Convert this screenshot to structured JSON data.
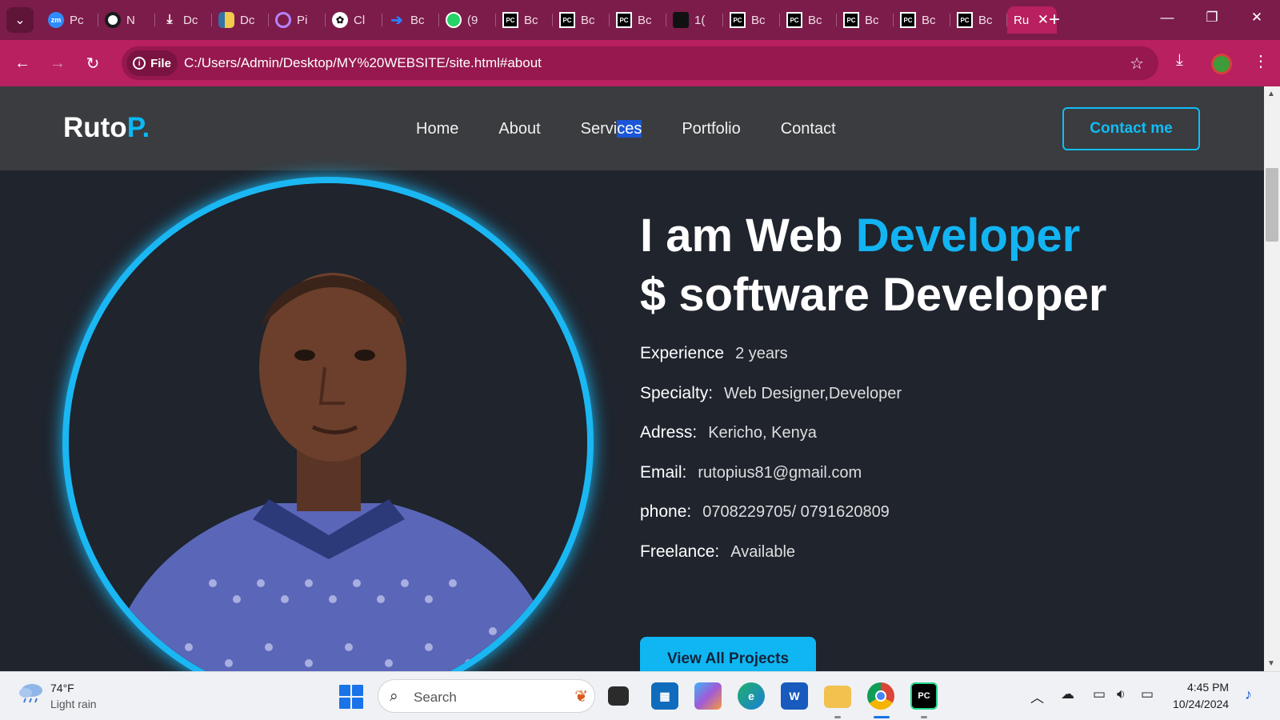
{
  "browser": {
    "tabs": [
      {
        "icon": "zoom-icon",
        "label": "Pc"
      },
      {
        "icon": "chrome-like-icon",
        "label": "N"
      },
      {
        "icon": "download-icon",
        "label": "Dc"
      },
      {
        "icon": "python-icon",
        "label": "Dc"
      },
      {
        "icon": "ring-icon",
        "label": "Pi"
      },
      {
        "icon": "chatgpt-icon",
        "label": "Cl"
      },
      {
        "icon": "arrow-logo-icon",
        "label": "Bc"
      },
      {
        "icon": "whatsapp-icon",
        "label": "(9"
      },
      {
        "icon": "pycharm-icon",
        "label": "Bc"
      },
      {
        "icon": "pycharm-icon",
        "label": "Bc"
      },
      {
        "icon": "pycharm-icon",
        "label": "Bc"
      },
      {
        "icon": "black-site-icon",
        "label": "1("
      },
      {
        "icon": "pycharm-icon",
        "label": "Bc"
      },
      {
        "icon": "pycharm-icon",
        "label": "Bc"
      },
      {
        "icon": "pycharm-icon",
        "label": "Bc"
      },
      {
        "icon": "pycharm-icon",
        "label": "Bc"
      },
      {
        "icon": "pycharm-icon",
        "label": "Bc"
      }
    ],
    "active_tab": {
      "label": "Ru",
      "close": "✕"
    },
    "new_tab": "+",
    "file_chip": "File",
    "url": "C:/Users/Admin/Desktop/MY%20WEBSITE/site.html#about"
  },
  "site": {
    "logo_main": "Ruto",
    "logo_accent": "P.",
    "nav": [
      "Home",
      "About",
      "Servi",
      "ces",
      "Portfolio",
      "Contact"
    ],
    "contact_button": "Contact me",
    "headline_line1_prefix": "I am Web",
    "headline_line1_accent": "Developer",
    "headline_line2": "$ software Developer",
    "info": [
      {
        "label": "Experience",
        "value": "2 years"
      },
      {
        "label": "Specialty:",
        "value": "Web Designer,Developer"
      },
      {
        "label": "Adress:",
        "value": "Kericho, Kenya"
      },
      {
        "label": "Email:",
        "value": "rutopius81@gmail.com"
      },
      {
        "label": "phone:",
        "value": "0708229705/ 0791620809"
      },
      {
        "label": "Freelance:",
        "value": "Available"
      }
    ],
    "projects_button": "View All Projects",
    "accent_color": "#0ab9f5"
  },
  "taskbar": {
    "weather_temp": "74°F",
    "weather_desc": "Light rain",
    "search_placeholder": "Search",
    "time": "4:45 PM",
    "date": "10/24/2024"
  }
}
